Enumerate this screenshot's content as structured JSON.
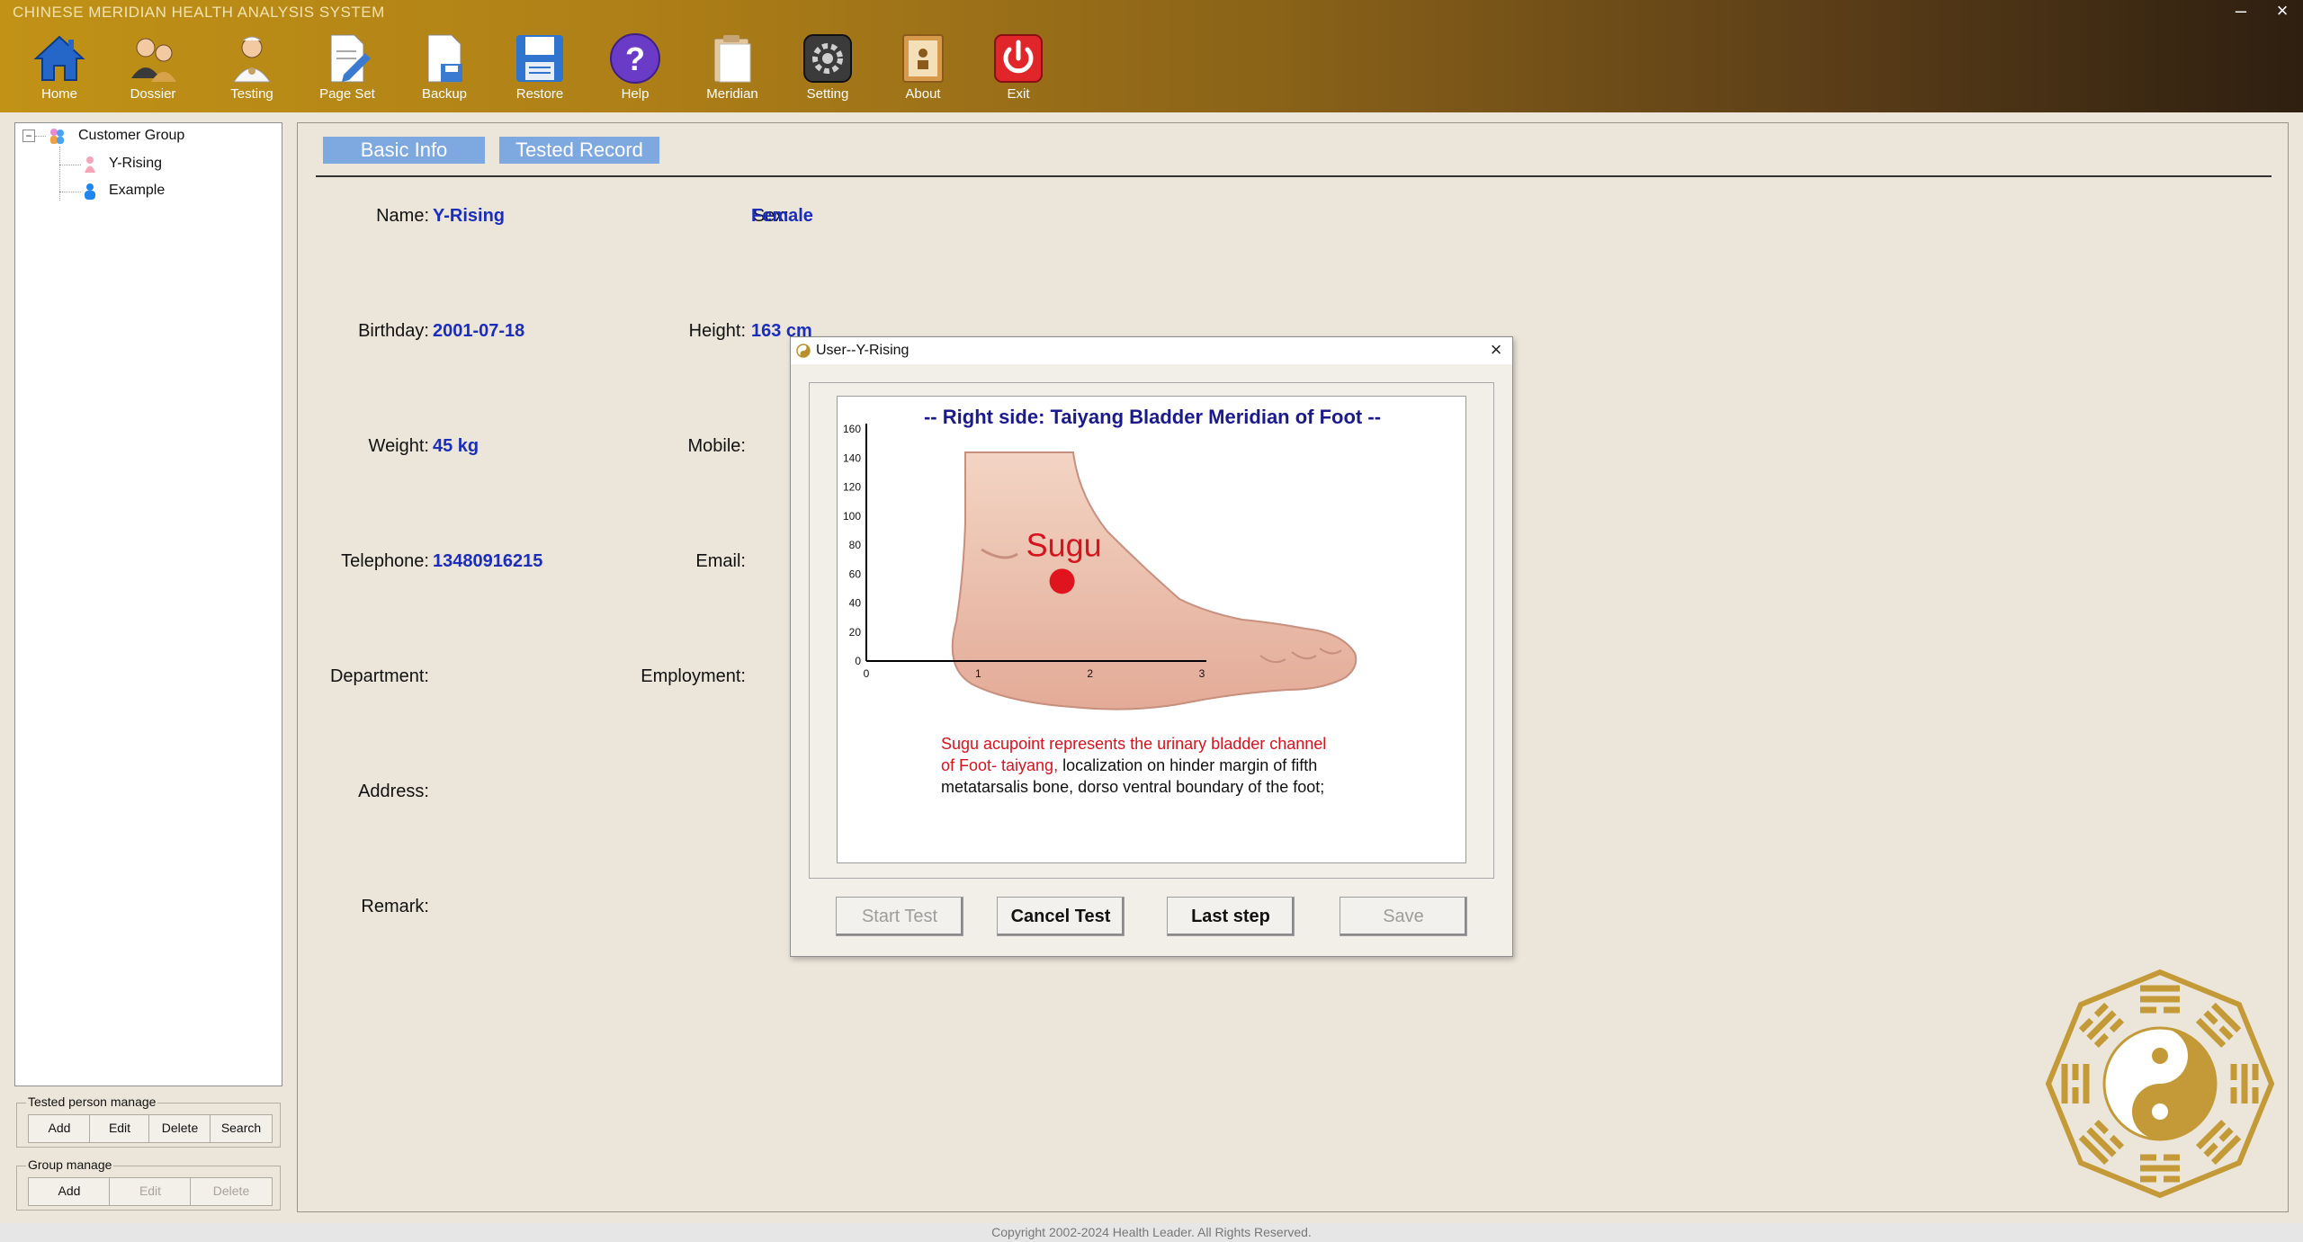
{
  "app": {
    "title": "CHINESE MERIDIAN HEALTH ANALYSIS SYSTEM",
    "copyright": "Copyright 2002-2024 Health Leader.  All Rights Reserved."
  },
  "toolbar": [
    {
      "label": "Home",
      "icon": "home-icon"
    },
    {
      "label": "Dossier",
      "icon": "dossier-icon"
    },
    {
      "label": "Testing",
      "icon": "doctor-icon"
    },
    {
      "label": "Page Set",
      "icon": "page-edit-icon"
    },
    {
      "label": "Backup",
      "icon": "backup-icon"
    },
    {
      "label": "Restore",
      "icon": "floppy-icon"
    },
    {
      "label": "Help",
      "icon": "help-icon"
    },
    {
      "label": "Meridian",
      "icon": "clipboard-icon"
    },
    {
      "label": "Setting",
      "icon": "gear-icon"
    },
    {
      "label": "About",
      "icon": "about-icon"
    },
    {
      "label": "Exit",
      "icon": "power-icon"
    }
  ],
  "tree": {
    "root": "Customer Group",
    "items": [
      "Y-Rising",
      "Example"
    ]
  },
  "tested_person_manage": {
    "title": "Tested person manage",
    "buttons": [
      "Add",
      "Edit",
      "Delete",
      "Search"
    ]
  },
  "group_manage": {
    "title": "Group manage",
    "buttons": [
      "Add",
      "Edit",
      "Delete"
    ]
  },
  "tabs": [
    "Basic Info",
    "Tested Record"
  ],
  "fields": {
    "name_label": "Name:",
    "name": "Y-Rising",
    "sex_label": "Sex:",
    "sex": "Female",
    "birthday_label": "Birthday:",
    "birthday": "2001-07-18",
    "height_label": "Height:",
    "height": "163 cm",
    "weight_label": "Weight:",
    "weight": "45 kg",
    "mobile_label": "Mobile:",
    "telephone_label": "Telephone:",
    "telephone": "13480916215",
    "email_label": "Email:",
    "department_label": "Department:",
    "employment_label": "Employment:",
    "address_label": "Address:",
    "remark_label": "Remark:"
  },
  "dialog": {
    "title": "User--Y-Rising",
    "buttons": {
      "start": "Start Test",
      "cancel": "Cancel Test",
      "last": "Last step",
      "save": "Save"
    }
  },
  "chart_data": {
    "type": "scatter",
    "title": "-- Right side: Taiyang Bladder Meridian of Foot --",
    "xlabel": "",
    "ylabel": "",
    "xlim": [
      0,
      3
    ],
    "ylim": [
      0,
      160
    ],
    "x_ticks": [
      "0",
      "1",
      "2",
      "3"
    ],
    "y_ticks": [
      "0",
      "20",
      "40",
      "60",
      "80",
      "100",
      "120",
      "140",
      "160"
    ],
    "grid": false,
    "points": [
      {
        "x": 1.75,
        "y": 55
      }
    ],
    "annotations": {
      "point_label": "Sugu",
      "desc_red": "Sugu acupoint represents the urinary bladder channel",
      "desc_red2": "of Foot- taiyang,",
      "desc_black2": " localization on hinder margin of fifth",
      "desc_black3": "metatarsalis bone, dorso ventral boundary of the foot;"
    },
    "colors": {
      "title": "#1a1a8c",
      "point": "#e0141e",
      "label": "#d4141e"
    }
  }
}
